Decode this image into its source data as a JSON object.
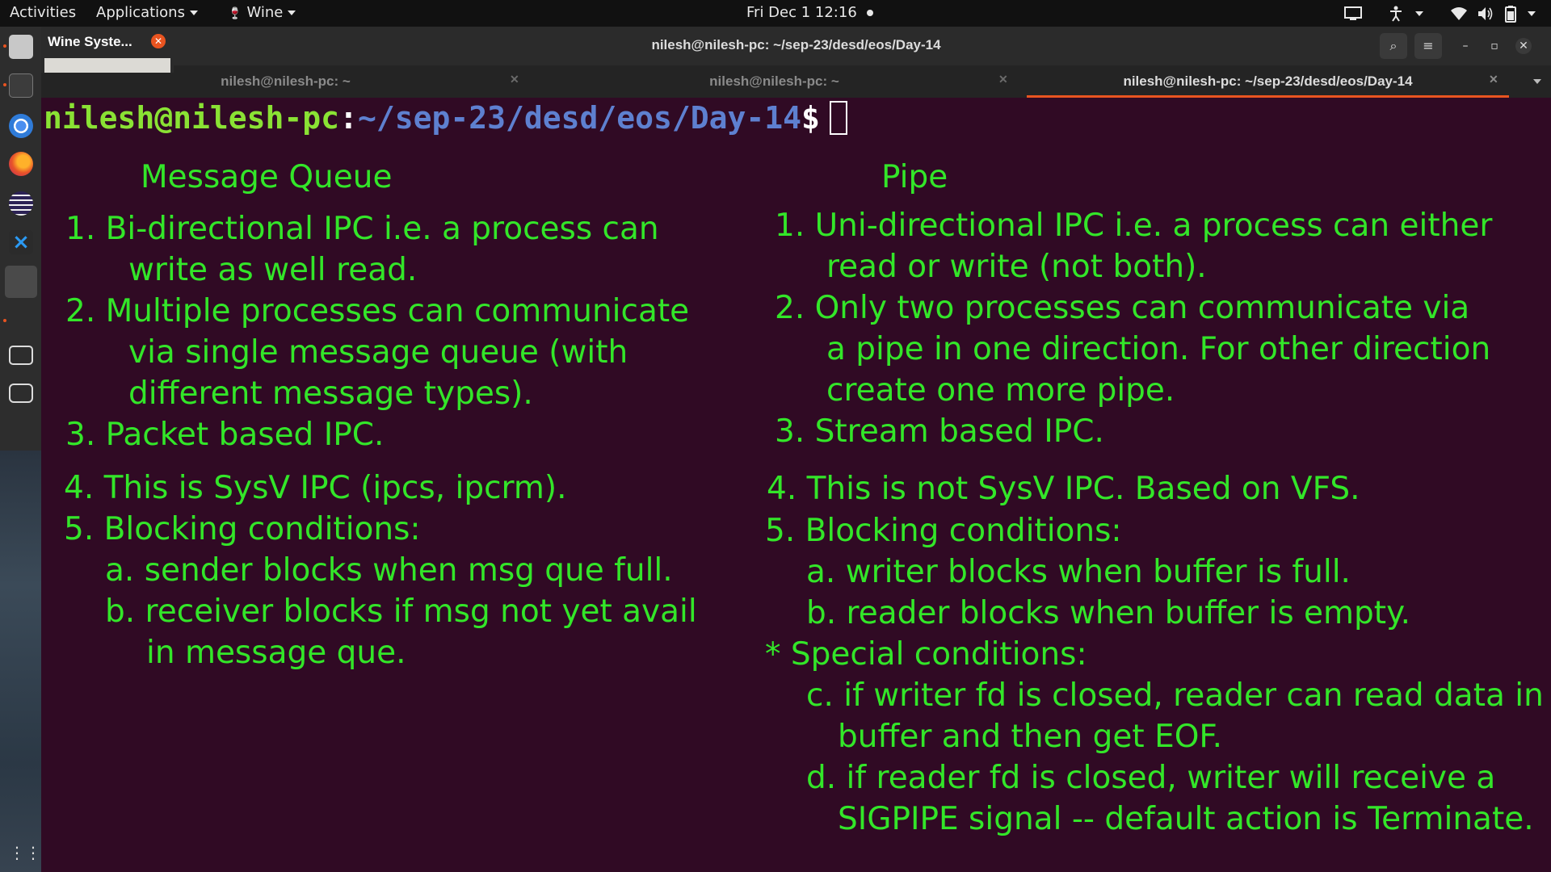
{
  "topbar": {
    "activities": "Activities",
    "applications": "Applications",
    "wine": "Wine",
    "clock": "Fri Dec 1  12:16"
  },
  "popup": {
    "title": "Wine Syste..."
  },
  "window": {
    "title": "nilesh@nilesh-pc: ~/sep-23/desd/eos/Day-14",
    "tabs": [
      {
        "label": "nilesh@nilesh-pc: ~"
      },
      {
        "label": "nilesh@nilesh-pc: ~"
      },
      {
        "label": "nilesh@nilesh-pc: ~/sep-23/desd/eos/Day-14"
      }
    ]
  },
  "terminal": {
    "prompt_user": "nilesh@nilesh-pc",
    "prompt_colon": ":",
    "prompt_path": "~/sep-23/desd/eos/Day-14",
    "prompt_dollar": "$"
  },
  "notes": {
    "left": {
      "heading": "Message Queue",
      "lines": [
        "1. Bi-directional IPC i.e. a process can",
        "write as well read.",
        "2. Multiple processes can communicate",
        "via single message queue (with",
        "different message types).",
        "3. Packet based IPC.",
        "4. This is SysV IPC (ipcs, ipcrm).",
        "5. Blocking conditions:",
        "a. sender blocks when msg que full.",
        "b. receiver blocks if msg not yet avail",
        "in message que."
      ]
    },
    "right": {
      "heading": "Pipe",
      "lines": [
        "1. Uni-directional IPC i.e. a process can either",
        "read or write (not both).",
        "2. Only two processes can communicate via",
        "a pipe in one direction. For other direction",
        "create one more pipe.",
        "3. Stream based IPC.",
        "4. This is not SysV IPC. Based on VFS.",
        "5. Blocking conditions:",
        "a. writer blocks when buffer is full.",
        "b. reader blocks when buffer is empty.",
        "* Special conditions:",
        "c. if writer fd is closed, reader can read data in",
        "buffer and then get EOF.",
        "d. if reader fd is closed, writer will receive a",
        "SIGPIPE signal -- default action is Terminate."
      ]
    }
  }
}
